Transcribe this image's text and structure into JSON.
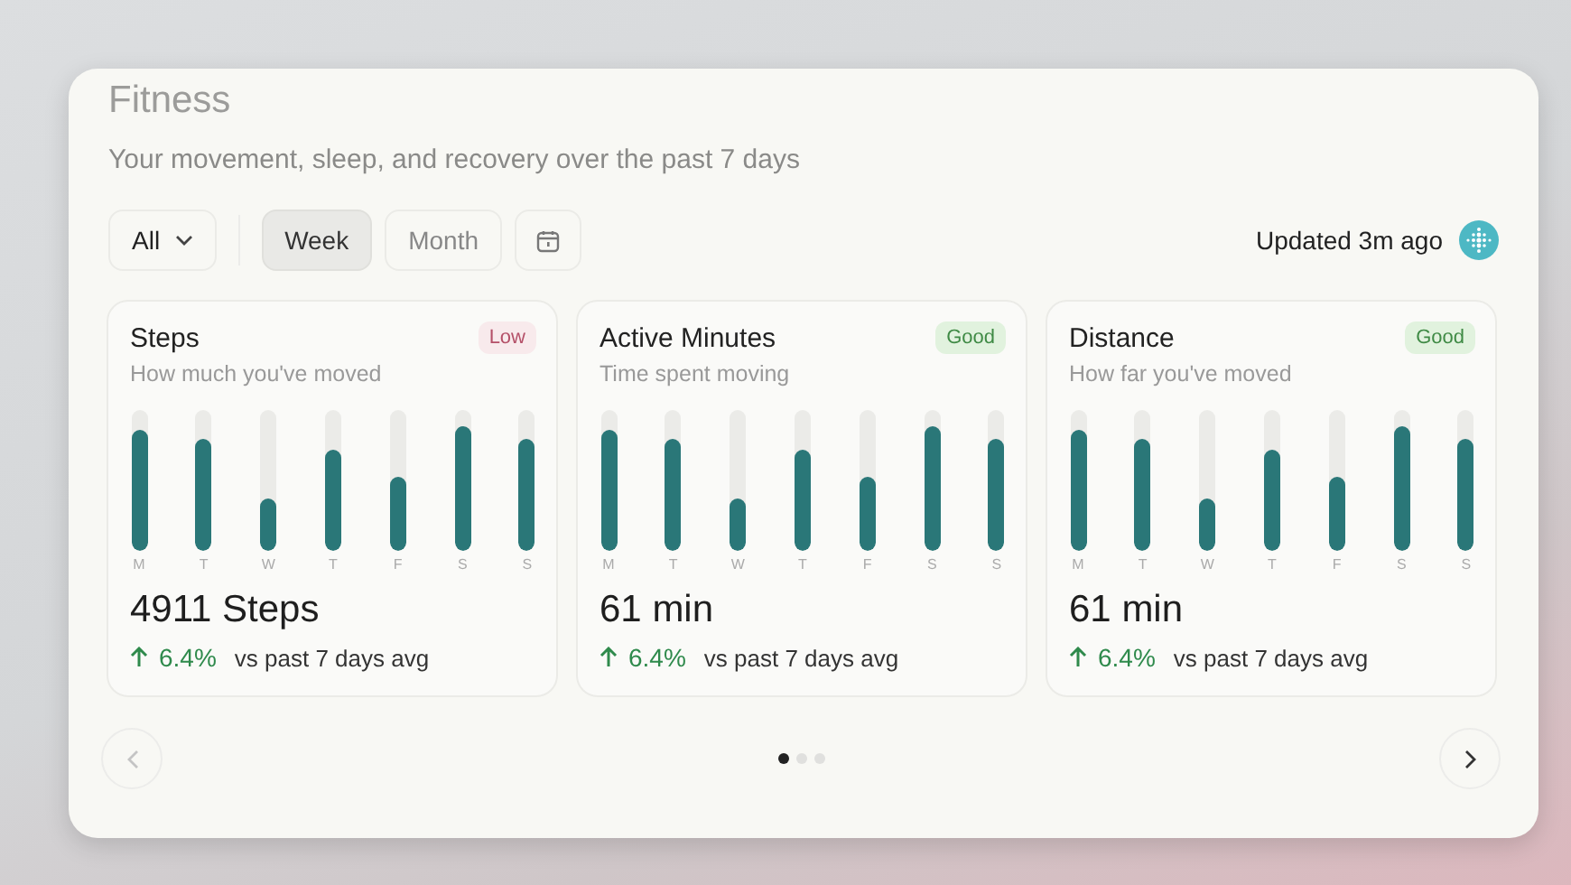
{
  "title": "Fitness",
  "subtitle": "Your movement, sleep, and recovery over the past 7 days",
  "filter": {
    "label": "All"
  },
  "ranges": [
    {
      "label": "Week",
      "selected": true
    },
    {
      "label": "Month",
      "selected": false
    }
  ],
  "updated": "Updated 3m ago",
  "cards": [
    {
      "title": "Steps",
      "subtitle": "How much you've moved",
      "badge": {
        "text": "Low",
        "kind": "low"
      },
      "bars": [
        {
          "day": "M",
          "level": 0.86
        },
        {
          "day": "T",
          "level": 0.8
        },
        {
          "day": "W",
          "level": 0.37
        },
        {
          "day": "T",
          "level": 0.72
        },
        {
          "day": "F",
          "level": 0.52
        },
        {
          "day": "S",
          "level": 0.88
        },
        {
          "day": "S",
          "level": 0.8
        }
      ],
      "value": "4911 Steps",
      "change": "6.4%",
      "compare": "vs past 7 days avg"
    },
    {
      "title": "Active Minutes",
      "subtitle": "Time spent moving",
      "badge": {
        "text": "Good",
        "kind": "good"
      },
      "bars": [
        {
          "day": "M",
          "level": 0.86
        },
        {
          "day": "T",
          "level": 0.8
        },
        {
          "day": "W",
          "level": 0.37
        },
        {
          "day": "T",
          "level": 0.72
        },
        {
          "day": "F",
          "level": 0.52
        },
        {
          "day": "S",
          "level": 0.88
        },
        {
          "day": "S",
          "level": 0.8
        }
      ],
      "value": "61 min",
      "change": "6.4%",
      "compare": "vs past 7 days avg"
    },
    {
      "title": "Distance",
      "subtitle": "How far you've moved",
      "badge": {
        "text": "Good",
        "kind": "good"
      },
      "bars": [
        {
          "day": "M",
          "level": 0.86
        },
        {
          "day": "T",
          "level": 0.8
        },
        {
          "day": "W",
          "level": 0.37
        },
        {
          "day": "T",
          "level": 0.72
        },
        {
          "day": "F",
          "level": 0.52
        },
        {
          "day": "S",
          "level": 0.88
        },
        {
          "day": "S",
          "level": 0.8
        }
      ],
      "value": "61 min",
      "change": "6.4%",
      "compare": "vs past 7 days avg"
    }
  ],
  "pager": {
    "prev_disabled": true,
    "pages": [
      {
        "selected": true
      },
      {
        "selected": false
      },
      {
        "selected": false
      }
    ]
  }
}
